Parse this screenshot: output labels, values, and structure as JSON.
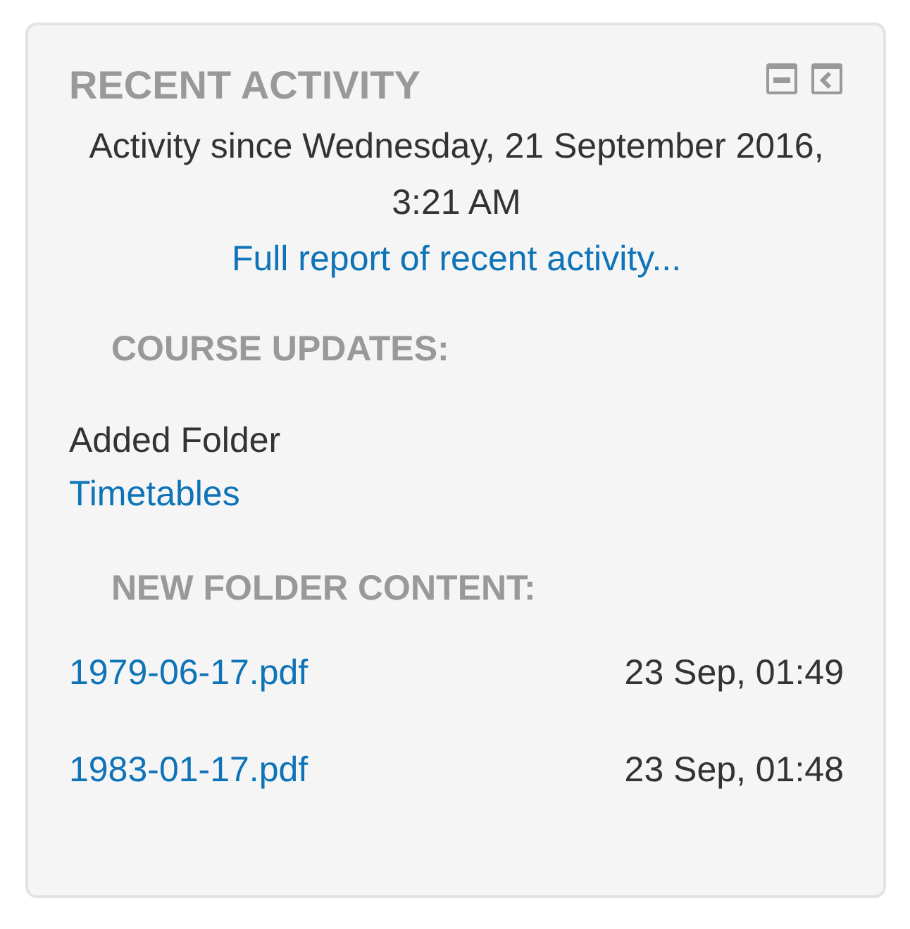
{
  "block": {
    "title": "RECENT ACTIVITY",
    "since": "Activity since Wednesday, 21 September 2016, 3:21 AM",
    "full_report_link": "Full report of recent activity..."
  },
  "sections": [
    {
      "heading": "COURSE UPDATES:",
      "kind": "updates",
      "action": "Added Folder",
      "link": "Timetables"
    },
    {
      "heading": "NEW FOLDER CONTENT:",
      "kind": "files",
      "files": [
        {
          "name": "1979-06-17.pdf",
          "time": "23 Sep, 01:49"
        },
        {
          "name": "1983-01-17.pdf",
          "time": "23 Sep, 01:48"
        }
      ]
    }
  ]
}
